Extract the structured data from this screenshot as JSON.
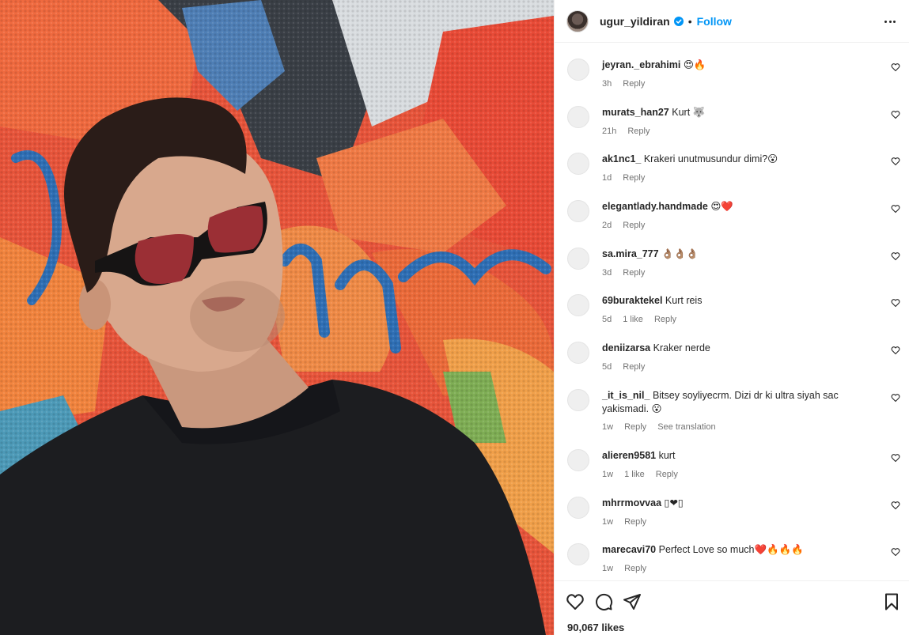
{
  "post": {
    "username": "ugur_yildiran",
    "follow_label": "Follow",
    "separator": "•"
  },
  "comments": [
    {
      "user": "jeyran._ebrahimi",
      "text": "😍🔥",
      "time": "3h",
      "likes": "",
      "reply": "Reply",
      "see_translation": ""
    },
    {
      "user": "murats_han27",
      "text": "Kurt 🐺",
      "time": "21h",
      "likes": "",
      "reply": "Reply",
      "see_translation": ""
    },
    {
      "user": "ak1nc1_",
      "text": "Krakeri unutmusundur dimi?😮",
      "time": "1d",
      "likes": "",
      "reply": "Reply",
      "see_translation": ""
    },
    {
      "user": "elegantlady.handmade",
      "text": "😍❤️",
      "time": "2d",
      "likes": "",
      "reply": "Reply",
      "see_translation": ""
    },
    {
      "user": "sa.mira_777",
      "text": "👌🏽👌🏽👌🏽",
      "time": "3d",
      "likes": "",
      "reply": "Reply",
      "see_translation": ""
    },
    {
      "user": "69buraktekel",
      "text": "Kurt reis",
      "time": "5d",
      "likes": "1 like",
      "reply": "Reply",
      "see_translation": ""
    },
    {
      "user": "deniizarsa",
      "text": "Kraker nerde",
      "time": "5d",
      "likes": "",
      "reply": "Reply",
      "see_translation": ""
    },
    {
      "user": "_it_is_nil_",
      "text": "Bitsey soyliyecrm. Dizi dr ki ultra siyah sac yakismadi. 😮",
      "time": "1w",
      "likes": "",
      "reply": "Reply",
      "see_translation": "See translation"
    },
    {
      "user": "alieren9581",
      "text": "kurt",
      "time": "1w",
      "likes": "1 like",
      "reply": "Reply",
      "see_translation": ""
    },
    {
      "user": "mhrrmovvaa",
      "text": "▯❤▯",
      "time": "1w",
      "likes": "",
      "reply": "Reply",
      "see_translation": ""
    },
    {
      "user": "marecavi70",
      "text": "Perfect Love so much❤️🔥🔥🔥",
      "time": "1w",
      "likes": "",
      "reply": "Reply",
      "see_translation": ""
    }
  ],
  "footer": {
    "likes_label": "90,067 likes"
  },
  "icons": {
    "like": "heart-icon",
    "comment": "comment-icon",
    "share": "share-icon",
    "save": "bookmark-icon",
    "more": "more-options-icon",
    "verified": "verified-badge-icon"
  },
  "colors": {
    "accent": "#0095f6",
    "text": "#262626",
    "muted": "#737373",
    "verified": "#0095f6"
  }
}
